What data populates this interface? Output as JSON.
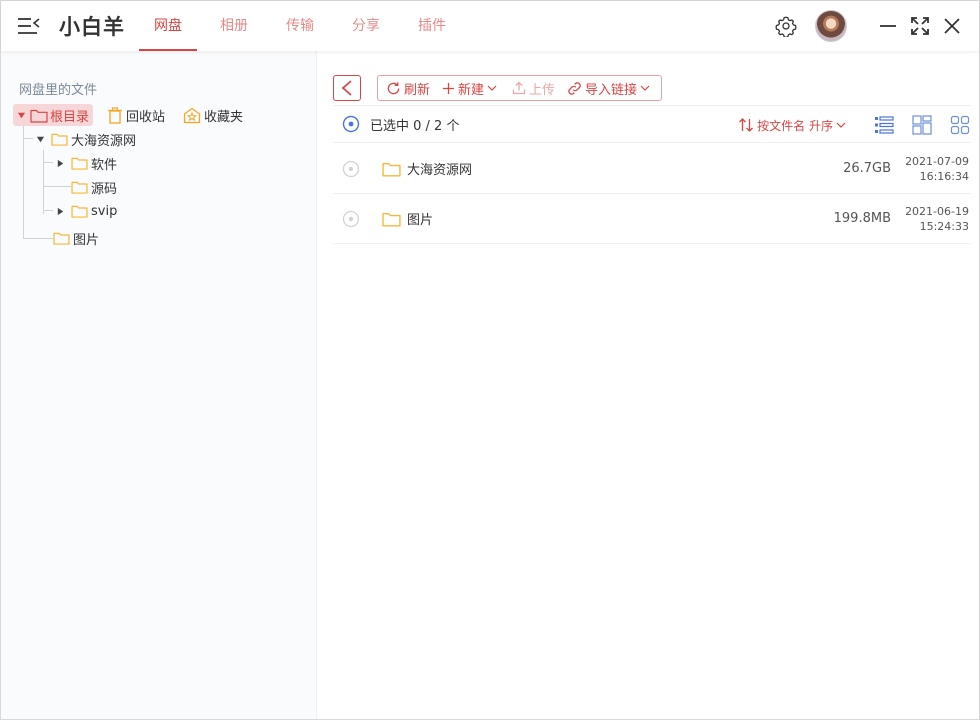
{
  "app": {
    "title": "小白羊"
  },
  "tabs": [
    {
      "label": "网盘",
      "active": true
    },
    {
      "label": "相册",
      "active": false
    },
    {
      "label": "传输",
      "active": false
    },
    {
      "label": "分享",
      "active": false
    },
    {
      "label": "插件",
      "active": false
    }
  ],
  "colors": {
    "accent": "#d84545",
    "folder": "#f5b83a",
    "select_ring": "#4a74d8"
  },
  "sidebar": {
    "title": "网盘里的文件",
    "root_label": "根目录",
    "recycle_label": "回收站",
    "favorites_label": "收藏夹",
    "tree": {
      "level1": "大海资源网",
      "level1_children": [
        "软件",
        "源码",
        "svip"
      ],
      "sibling": "图片"
    }
  },
  "toolbar": {
    "refresh": "刷新",
    "new": "新建",
    "upload": "上传",
    "import_link": "导入链接"
  },
  "list": {
    "selection": "已选中 0 / 2 个",
    "sort_label": "按文件名 升序",
    "rows": [
      {
        "name": "大海资源网",
        "size": "26.7GB",
        "date": "2021-07-09",
        "time": "16:16:34"
      },
      {
        "name": "图片",
        "size": "199.8MB",
        "date": "2021-06-19",
        "time": "15:24:33"
      }
    ]
  }
}
